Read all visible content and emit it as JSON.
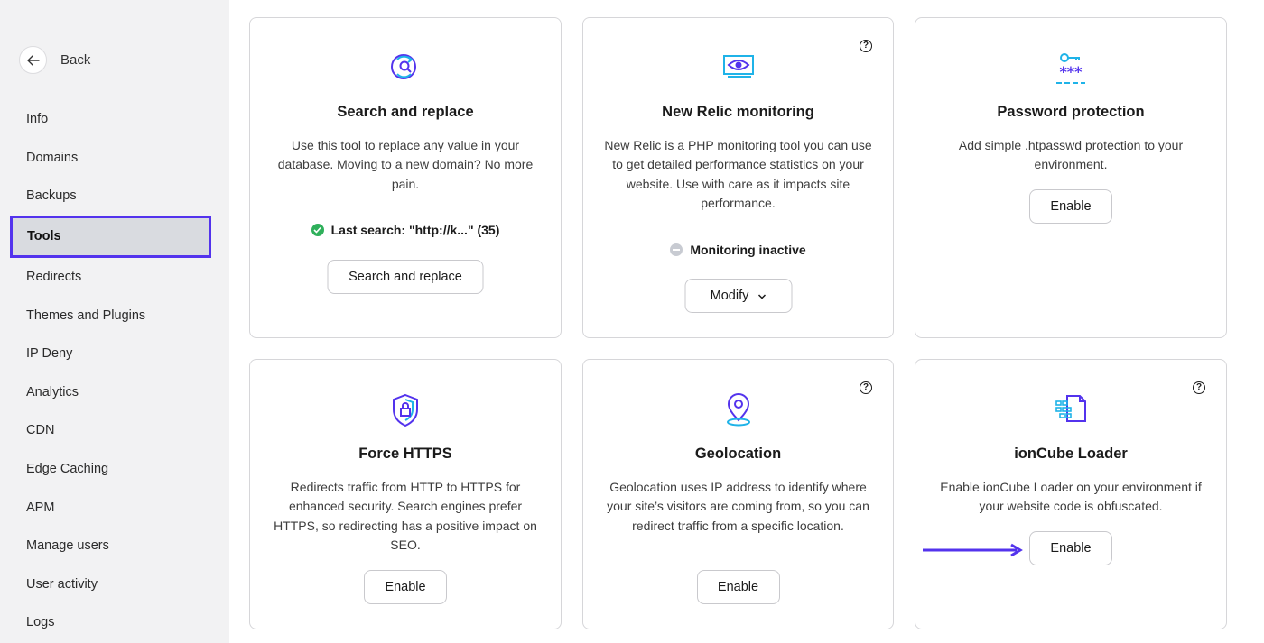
{
  "sidebar": {
    "back_label": "Back",
    "items": [
      {
        "label": "Info"
      },
      {
        "label": "Domains"
      },
      {
        "label": "Backups"
      },
      {
        "label": "Tools",
        "active": true
      },
      {
        "label": "Redirects"
      },
      {
        "label": "Themes and Plugins"
      },
      {
        "label": "IP Deny"
      },
      {
        "label": "Analytics"
      },
      {
        "label": "CDN"
      },
      {
        "label": "Edge Caching"
      },
      {
        "label": "APM"
      },
      {
        "label": "Manage users"
      },
      {
        "label": "User activity"
      },
      {
        "label": "Logs"
      }
    ]
  },
  "cards": {
    "search_replace": {
      "icon": "search-replace-icon",
      "title": "Search and replace",
      "description": "Use this tool to replace any value in your database. Moving to a new domain? No more pain.",
      "status": "Last search: \"http://k...\" (35)",
      "button": "Search and replace"
    },
    "new_relic": {
      "icon": "monitoring-eye-icon",
      "title": "New Relic monitoring",
      "description": "New Relic is a PHP monitoring tool you can use to get detailed performance statistics on your website. Use with care as it impacts site performance.",
      "status": "Monitoring inactive",
      "button": "Modify"
    },
    "password": {
      "icon": "password-key-icon",
      "title": "Password protection",
      "description": "Add simple .htpasswd protection to your environment.",
      "button": "Enable"
    },
    "https": {
      "icon": "shield-lock-icon",
      "title": "Force HTTPS",
      "description": "Redirects traffic from HTTP to HTTPS for enhanced security. Search engines prefer HTTPS, so redirecting has a positive impact on SEO.",
      "button": "Enable"
    },
    "geolocation": {
      "icon": "location-pin-icon",
      "title": "Geolocation",
      "description": "Geolocation uses IP address to identify where your site’s visitors are coming from, so you can redirect traffic from a specific location.",
      "button": "Enable"
    },
    "ioncube": {
      "icon": "ioncube-file-icon",
      "title": "ionCube Loader",
      "description": "Enable ionCube Loader on your environment if your website code is obfuscated.",
      "button": "Enable"
    }
  },
  "help_glyph": "?",
  "colors": {
    "accent": "#5333ed",
    "icon_cyan": "#1fb3e8",
    "success": "#2fb05b"
  }
}
